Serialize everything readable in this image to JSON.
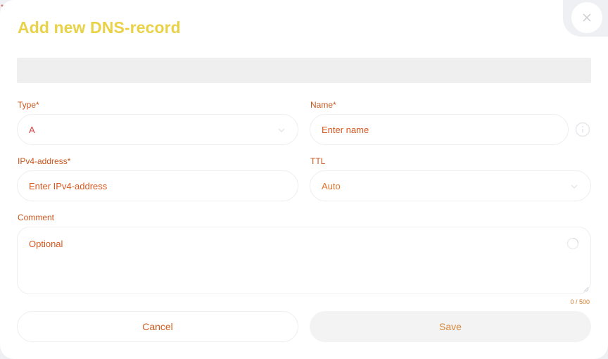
{
  "dialog": {
    "title": "Add new DNS-record",
    "corner_mark": "*"
  },
  "form": {
    "type": {
      "label": "Type*",
      "value": "A"
    },
    "name": {
      "label": "Name*",
      "placeholder": "Enter name"
    },
    "ip": {
      "label": "IPv4-address*",
      "placeholder": "Enter IPv4-address"
    },
    "ttl": {
      "label": "TTL",
      "value": "Auto"
    },
    "comment": {
      "label": "Comment",
      "placeholder": "Optional",
      "counter": "0 / 500"
    }
  },
  "actions": {
    "cancel_label": "Cancel",
    "save_label": "Save"
  },
  "icons": {
    "close": "close-icon",
    "info": "info-icon",
    "chevron": "chevron-down-icon",
    "spinner": "loading-icon",
    "resize": "resize-grip-icon"
  },
  "colors": {
    "title": "#e9d247",
    "label": "#c7561e",
    "banner": "#efefef",
    "backdrop": "#eef0f3"
  }
}
